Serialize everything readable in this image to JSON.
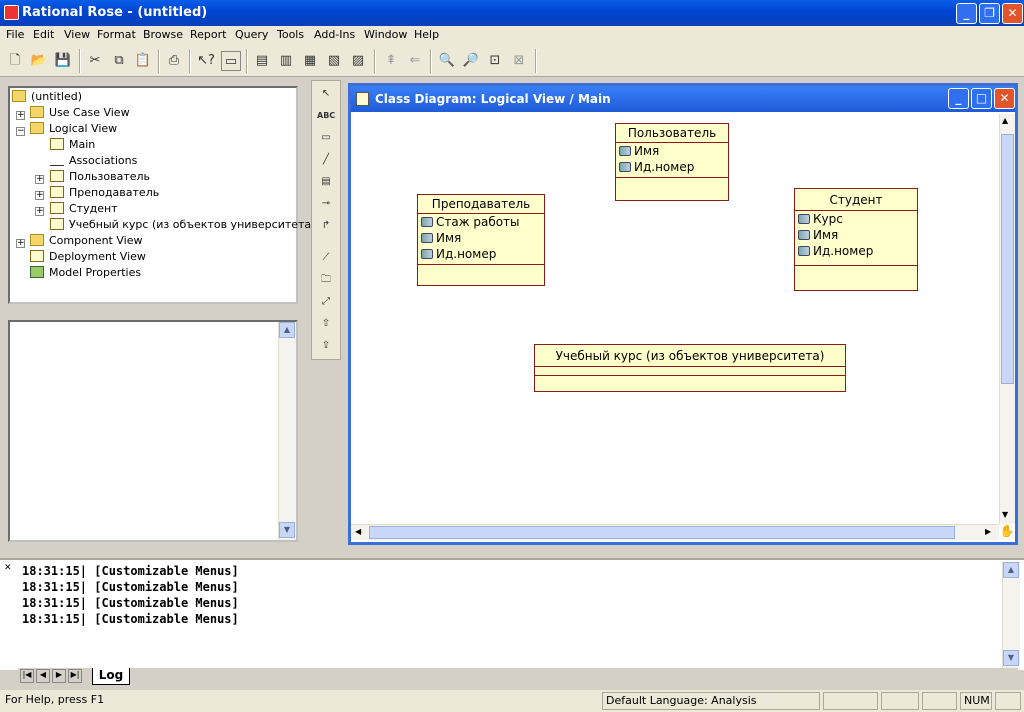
{
  "window": {
    "title": "Rational Rose - (untitled)"
  },
  "menu": [
    "File",
    "Edit",
    "View",
    "Format",
    "Browse",
    "Report",
    "Query",
    "Tools",
    "Add-Ins",
    "Window",
    "Help"
  ],
  "tree": {
    "root": "(untitled)",
    "use_case_view": "Use Case View",
    "logical_view": "Logical View",
    "main": "Main",
    "associations": "Associations",
    "cls1": "Пользователь",
    "cls2": "Преподаватель",
    "cls3": "Студент",
    "cls4": "Учебный курс (из объектов университета)",
    "component_view": "Component View",
    "deployment_view": "Deployment View",
    "model_properties": "Model Properties"
  },
  "palette_abc": "ABC",
  "diagram": {
    "title": "Class Diagram: Logical View / Main",
    "classes": {
      "user": {
        "name": "Пользователь",
        "attrs": [
          "Имя",
          "Ид.номер"
        ]
      },
      "teacher": {
        "name": "Преподаватель",
        "attrs": [
          "Стаж работы",
          "Имя",
          "Ид.номер"
        ]
      },
      "student": {
        "name": "Студент",
        "attrs": [
          "Курс",
          "Имя",
          "Ид.номер"
        ]
      },
      "course": {
        "name": "Учебный курс (из объектов университета)",
        "attrs": []
      }
    }
  },
  "log": {
    "lines": [
      "18:31:15|  [Customizable Menus]",
      "18:31:15|  [Customizable Menus]",
      "18:31:15|  [Customizable Menus]",
      "18:31:15|  [Customizable Menus]"
    ],
    "tab": "Log"
  },
  "status": {
    "help": "For Help, press F1",
    "language": "Default Language: Analysis",
    "num": "NUM"
  }
}
